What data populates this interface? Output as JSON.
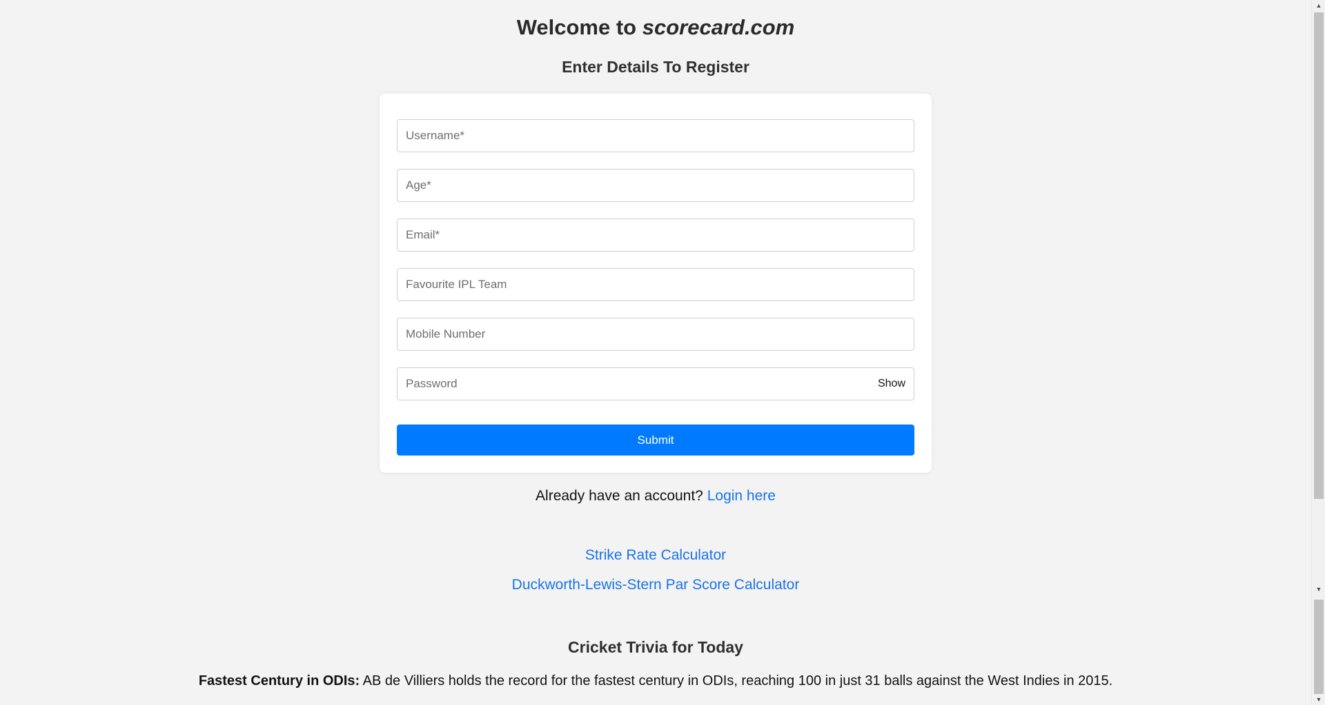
{
  "header": {
    "title_prefix": "Welcome to ",
    "title_site": "scorecard.com",
    "subtitle": "Enter Details To Register"
  },
  "form": {
    "username_placeholder": "Username*",
    "age_placeholder": "Age*",
    "email_placeholder": "Email*",
    "team_placeholder": "Favourite IPL Team",
    "mobile_placeholder": "Mobile Number",
    "password_placeholder": "Password",
    "show_label": "Show",
    "submit_label": "Submit"
  },
  "login": {
    "prompt": "Already have an account?",
    "link": "Login here"
  },
  "links": {
    "strike_rate": "Strike Rate Calculator",
    "dls": "Duckworth-Lewis-Stern Par Score Calculator"
  },
  "trivia": {
    "title": "Cricket Trivia for Today",
    "label": "Fastest Century in ODIs:",
    "text": "AB de Villiers holds the record for the fastest century in ODIs, reaching 100 in just 31 balls against the West Indies in 2015."
  },
  "colors": {
    "accent": "#007bff",
    "link": "#1a73e8",
    "background": "#f3f3f3"
  }
}
